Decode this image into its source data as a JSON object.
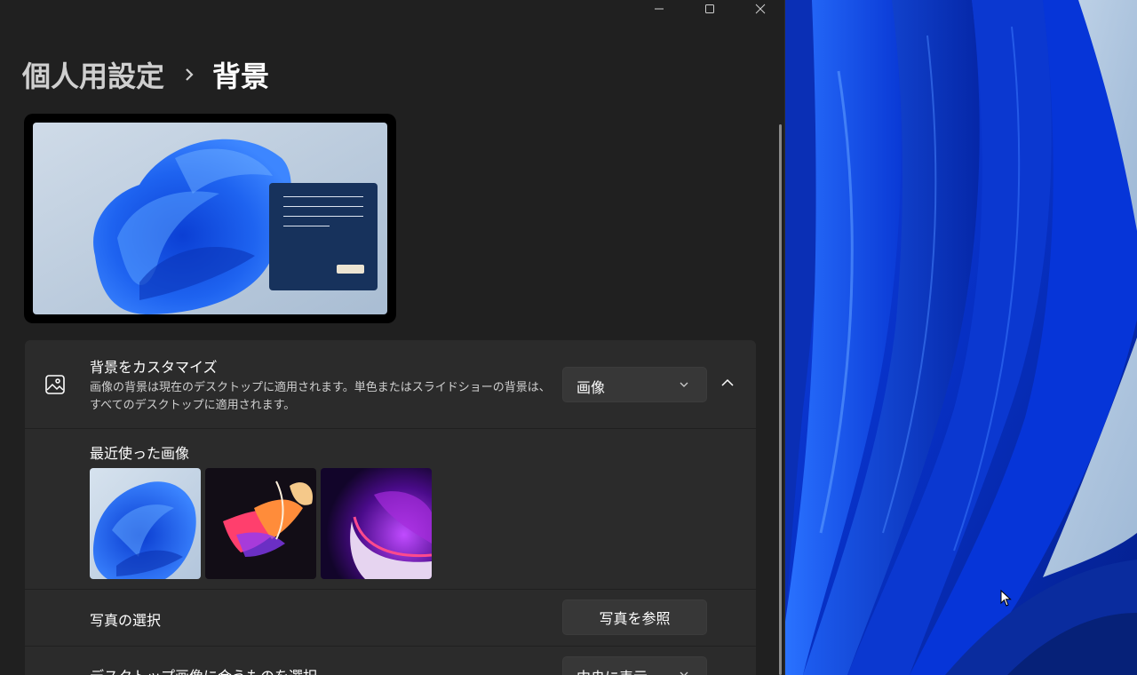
{
  "window": {
    "caption": {
      "minimize_icon": "minimize-icon",
      "maximize_icon": "maximize-icon",
      "close_icon": "close-icon"
    }
  },
  "breadcrumb": {
    "parent": "個人用設定",
    "separator_icon": "chevron-right-icon",
    "current": "背景"
  },
  "preview": {
    "accent_window_color": "#17325c",
    "button_color": "#ece4d2"
  },
  "customize": {
    "icon": "picture-icon",
    "title": "背景をカスタマイズ",
    "description_line1": "画像の背景は現在のデスクトップに適用されます。単色またはスライドショーの背景は、",
    "description_line2": "すべてのデスクトップに適用されます。",
    "dropdown_value": "画像",
    "collapse_icon": "chevron-up-icon"
  },
  "recent": {
    "title": "最近使った画像",
    "images": [
      "bloom-light-wallpaper",
      "abstract-ribbon-wallpaper",
      "purple-glow-wallpaper"
    ]
  },
  "photo": {
    "label": "写真の選択",
    "button": "写真を参照"
  },
  "fit": {
    "label": "デスクトップ画像に合うものを選択",
    "dropdown_value": "中央に表示"
  },
  "colors": {
    "window_bg": "#202020",
    "card_bg": "#2b2b2b",
    "control_bg": "#373737",
    "desktop_blue": "#0a2aa8"
  }
}
